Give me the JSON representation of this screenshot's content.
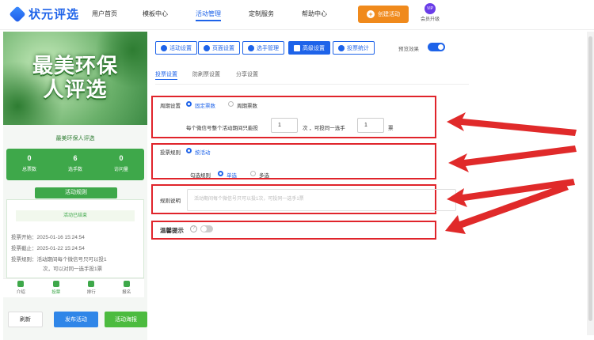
{
  "header": {
    "brand": "状元评选",
    "nav": [
      "用户首页",
      "模板中心",
      "活动管理",
      "定制服务",
      "帮助中心"
    ],
    "active_nav": "活动管理",
    "create_button": "创建活动",
    "vip_badge": "VIP",
    "vip_label": "会员升级"
  },
  "preview_panel": {
    "banner_title_line1": "最美环保",
    "banner_title_line2": "人评选",
    "event_name": "最美环保人评选",
    "stats": [
      {
        "value": "0",
        "label": "总票数"
      },
      {
        "value": "6",
        "label": "选手数"
      },
      {
        "value": "0",
        "label": "访问量"
      }
    ],
    "rules_heading": "活动规则",
    "status_badge": "活动已结束",
    "info_lines": [
      "投票开始：2025-01-16 15:24:54",
      "投票截止：2025-01-22 15:24:54",
      "投票规则：活动期间每个微信号只可以投1",
      "次，可以对同一选手投1票"
    ],
    "tabs": [
      "介绍",
      "投票",
      "排行",
      "报名"
    ],
    "active_tab": "投票"
  },
  "bottom_buttons": {
    "refresh": "刷新",
    "publish": "发布活动",
    "poster": "活动海报"
  },
  "toolbar": {
    "buttons": [
      "活动设置",
      "页面设置",
      "选手管理",
      "高级设置",
      "投票统计"
    ],
    "active": "高级设置",
    "preview_label": "预览效果",
    "preview_enabled": true
  },
  "subtabs": {
    "items": [
      "投票设置",
      "防刷票设置",
      "分享设置"
    ],
    "active": "投票设置"
  },
  "vote_settings": {
    "period_label": "周期设置",
    "period_options": [
      "固定票数",
      "周期票数"
    ],
    "period_selected": "固定票数",
    "limit_prefix": "每个微信号整个活动期间只能投",
    "total_votes": "1",
    "limit_middle": "次 ，可投同一选手",
    "same_candidate_votes": "1",
    "limit_suffix": "票",
    "rule_label": "投票规则",
    "rule_option": "按活动",
    "select_rule_label": "勾选规则",
    "select_options": [
      "单选",
      "多选"
    ],
    "select_selected": "单选",
    "desc_label": "规则说明",
    "desc_placeholder": "活动期间每个微信号只可以投1次，可投同一选手1票",
    "reminder_label": "温馨提示",
    "reminder_help": "?",
    "reminder_enabled": false
  }
}
